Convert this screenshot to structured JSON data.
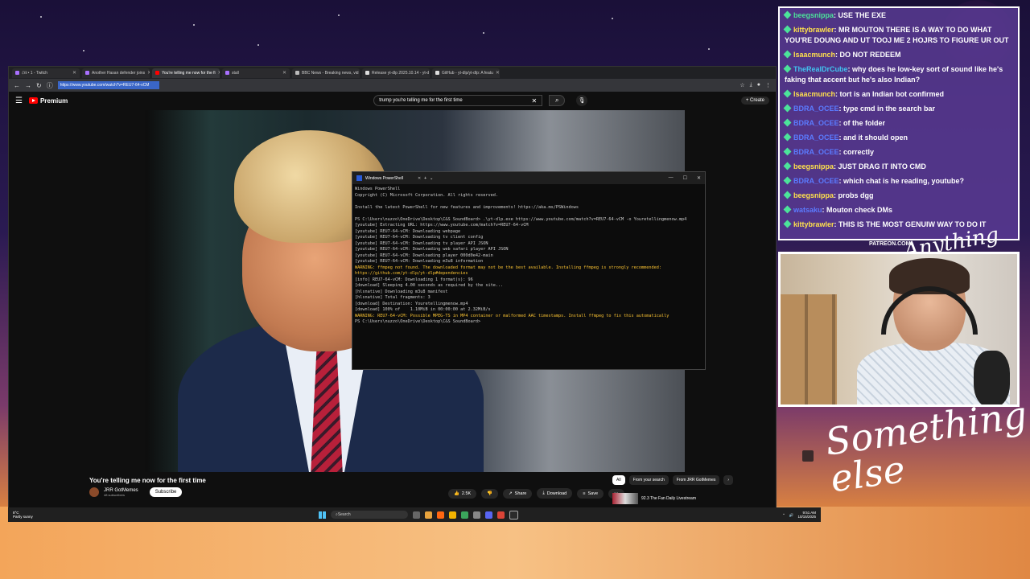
{
  "colors": {
    "accent": "#a970ff",
    "chat_bg": "#5c3c96",
    "youtube_red": "#ff0000",
    "ps_warning": "#f9c232",
    "ps_green": "#16c60c"
  },
  "browser": {
    "tabs": [
      {
        "label": "ℰℓℓ • 1 - Twitch",
        "icon": "twitch-icon"
      },
      {
        "label": "Another Hasan defender joins",
        "icon": "tab-icon"
      },
      {
        "label": "You're telling me now for the fi",
        "icon": "youtube-icon",
        "active": true
      },
      {
        "label": "stall",
        "icon": "tab-icon"
      },
      {
        "label": "BBC News - Breaking news, vid",
        "icon": "bbc-icon"
      },
      {
        "label": "Release yt-dlp 2025.10.14 - yt-d",
        "icon": "github-icon"
      },
      {
        "label": "GitHub - yt-dlp/yt-dlp: A featu",
        "icon": "github-icon"
      }
    ],
    "url": "https://www.youtube.com/watch?v=REU7-64-vCM"
  },
  "youtube": {
    "logo_text": "Premium",
    "search_value": "trump you're telling me for the first time",
    "create_label": "Create",
    "video_title": "You're telling me now for the first time",
    "channel_name": "JRR GotMemes",
    "subscribers": "48 subscribers",
    "subscribe_label": "Subscribe",
    "likes": "2.5K",
    "share_label": "Share",
    "download_label": "Download",
    "save_label": "Save",
    "chips": [
      "All",
      "From your search",
      "From JRR GotMemes"
    ],
    "rec_title": "92.3 The Fan Daily Livestream"
  },
  "powershell": {
    "window_title": "Windows PowerShell",
    "lines": [
      {
        "t": "Windows PowerShell",
        "k": "n"
      },
      {
        "t": "Copyright (C) Microsoft Corporation. All rights reserved.",
        "k": "n"
      },
      {
        "t": "",
        "k": "n"
      },
      {
        "t": "Install the latest PowerShell for new features and improvements! https://aka.ms/PSWindows",
        "k": "n"
      },
      {
        "t": "",
        "k": "n"
      },
      {
        "t": "PS C:\\Users\\nuzzo\\OneDrive\\Desktop\\C&S SoundBoard> .\\yt-dlp.exe https://www.youtube.com/match?v=REU7-64-vCM -o Youretellingmenow.mp4",
        "k": "n"
      },
      {
        "t": "[youtube] Extracting URL: https://www.youtube.com/match?v=REU7-64-vCM",
        "k": "n"
      },
      {
        "t": "[youtube] REU7-64-vCM: Downloading webpage",
        "k": "n"
      },
      {
        "t": "[youtube] REU7-64-vCM: Downloading tv client config",
        "k": "n"
      },
      {
        "t": "[youtube] REU7-64-vCM: Downloading tv player API JSON",
        "k": "n"
      },
      {
        "t": "[youtube] REU7-64-vCM: Downloading web safari player API JSON",
        "k": "n"
      },
      {
        "t": "[youtube] REU7-64-vCM: Downloading player 000d0e42-main",
        "k": "n"
      },
      {
        "t": "[youtube] REU7-64-vCM: Downloading m3u8 information",
        "k": "n"
      },
      {
        "t": "WARNING: ffmpeg not found. The downloaded format may not be the best available. Installing ffmpeg is strongly recommended: https://github.com/yt-dlp/yt-dlp#dependencies",
        "k": "w"
      },
      {
        "t": "[info] REU7-64-vCM: Downloading 1 format(s): 96",
        "k": "n"
      },
      {
        "t": "[download] Sleeping 4.00 seconds as required by the site...",
        "k": "n"
      },
      {
        "t": "[hlsnative] Downloading m3u8 manifest",
        "k": "n"
      },
      {
        "t": "[hlsnative] Total fragments: 3",
        "k": "n"
      },
      {
        "t": "[download] Destination: Youretellingmenow.mp4",
        "k": "n"
      },
      {
        "t": "[download] 100% of    1.10MiB in 00:00:00 at 2.32MiB/s",
        "k": "n"
      },
      {
        "t": "WARNING: REU7-64-vCM: Possible MPEG-TS in MP4 container or malformed AAC timestamps. Install ffmpeg to fix this automatically",
        "k": "w"
      },
      {
        "t": "PS C:\\Users\\nuzzo\\OneDrive\\Desktop\\C&S SoundBoard>",
        "k": "n"
      }
    ]
  },
  "taskbar": {
    "weather_temp": "8°C",
    "weather_desc": "Partly sunny",
    "search_placeholder": "Search",
    "time": "9:51 AM",
    "date": "10/15/2025"
  },
  "chat": {
    "messages": [
      {
        "user": "beegsnippa",
        "text": "USE THE EXE",
        "color": "#4ce39a"
      },
      {
        "user": "kittybrawler",
        "text": "MR MOUTON THERE IS A WAY TO DO WHAT YOU'RE DOUNG AND UT TOOJ ME 2 HOJRS TO FIGURE UR OUT",
        "color": "#ffe14c"
      },
      {
        "user": "Isaacmunch",
        "text": "DO NOT REDEEM",
        "color": "#ffe14c"
      },
      {
        "user": "TheRealDrCube",
        "text": "why does he low-key sort of sound like he's faking that accent but he's also Indian?",
        "color": "#41c3f0"
      },
      {
        "user": "Isaacmunch",
        "text": "tort is an Indian bot confirmed",
        "color": "#ffe14c"
      },
      {
        "user": "BDRA_OCEE",
        "text": "type cmd in the search bar",
        "color": "#5b7bff"
      },
      {
        "user": "BDRA_OCEE",
        "text": "of the folder",
        "color": "#5b7bff"
      },
      {
        "user": "BDRA_OCEE",
        "text": "and it should open",
        "color": "#5b7bff"
      },
      {
        "user": "BDRA_OCEE",
        "text": "correctly",
        "color": "#5b7bff"
      },
      {
        "user": "beegsnippa",
        "text": "JUST DRAG IT INTO CMD",
        "color": "#ffe14c"
      },
      {
        "user": "BDRA_OCEE",
        "text": "which chat is he reading, youtube?",
        "color": "#5b7bff"
      },
      {
        "user": "beegsnippa",
        "text": "probs dgg",
        "color": "#ffe14c"
      },
      {
        "user": "watsaku",
        "text": "Mouton check DMs",
        "color": "#5b7bff"
      },
      {
        "user": "kittybrawler",
        "text": "THIS IS THE MOST GENUIW WAY TO DO IT",
        "color": "#ffe14c"
      }
    ]
  },
  "overlay": {
    "patreon": "PATREON.COM/",
    "signature": "Anything else",
    "brand_text": "Something else"
  }
}
